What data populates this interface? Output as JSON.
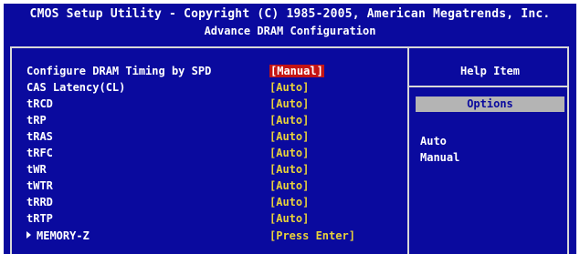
{
  "header": {
    "title": "CMOS Setup Utility - Copyright (C) 1985-2005, American Megatrends, Inc.",
    "subtitle": "Advance DRAM Configuration"
  },
  "items": [
    {
      "label": "Configure DRAM Timing by SPD",
      "value": "[Manual]"
    },
    {
      "label": "CAS Latency(CL)",
      "value": "[Auto]"
    },
    {
      "label": "tRCD",
      "value": "[Auto]"
    },
    {
      "label": "tRP",
      "value": "[Auto]"
    },
    {
      "label": "tRAS",
      "value": "[Auto]"
    },
    {
      "label": "tRFC",
      "value": "[Auto]"
    },
    {
      "label": "tWR",
      "value": "[Auto]"
    },
    {
      "label": "tWTR",
      "value": "[Auto]"
    },
    {
      "label": "tRRD",
      "value": "[Auto]"
    },
    {
      "label": "tRTP",
      "value": "[Auto]"
    },
    {
      "label": "MEMORY-Z",
      "value": "[Press Enter]"
    }
  ],
  "help": {
    "title": "Help Item",
    "options_header": "Options",
    "options": [
      "Auto",
      "Manual"
    ]
  },
  "colors": {
    "background": "#0a0a9e",
    "value_text": "#e8d23a",
    "selected_highlight": "#c41414",
    "options_bar": "#b4b4b4"
  }
}
